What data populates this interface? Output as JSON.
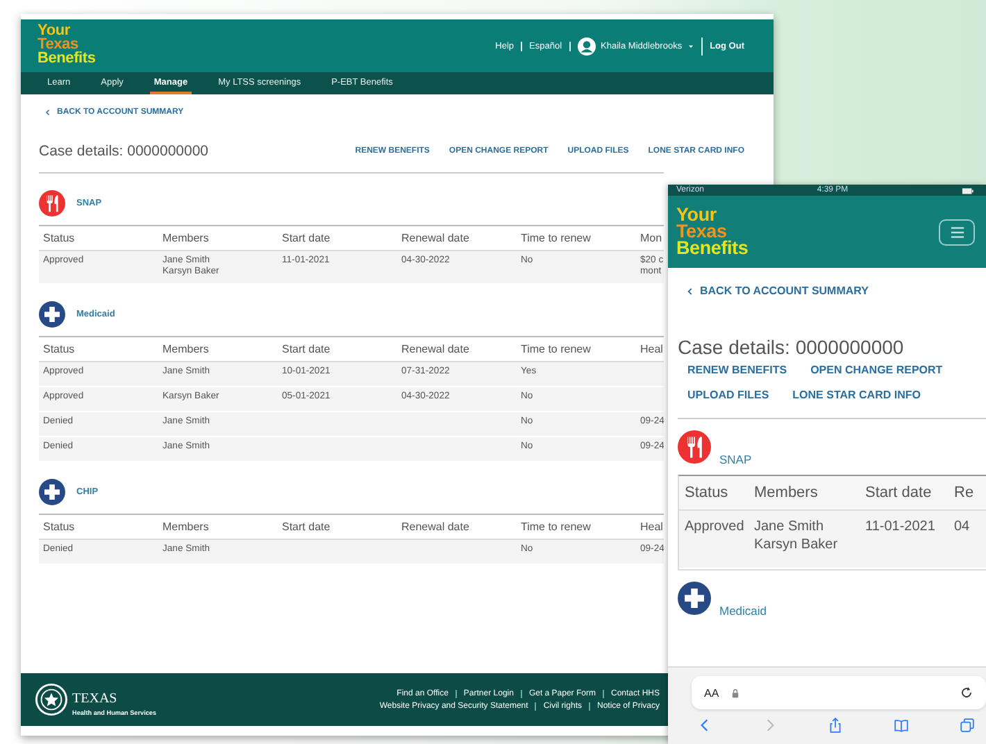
{
  "desktop": {
    "logo": [
      "Your",
      "Texas",
      "Benefits"
    ],
    "top_links": [
      "Help",
      "Español"
    ],
    "user_name": "Khaila Middlebrooks",
    "logout": "Log Out",
    "nav": [
      {
        "label": "Learn",
        "selected": false
      },
      {
        "label": "Apply",
        "selected": false
      },
      {
        "label": "Manage",
        "selected": true
      },
      {
        "label": "My LTSS screenings",
        "selected": false
      },
      {
        "label": "P-EBT Benefits",
        "selected": false
      }
    ],
    "back_link": "BACK TO ACCOUNT SUMMARY",
    "case_title": "Case details: 0000000000",
    "actions": [
      "RENEW BENEFITS",
      "OPEN CHANGE REPORT",
      "UPLOAD FILES",
      "LONE STAR CARD INFO"
    ],
    "programs": [
      {
        "name": "SNAP",
        "kind": "food",
        "columns": [
          "Status",
          "Members",
          "Start date",
          "Renewal date",
          "Time to renew",
          "Mon"
        ],
        "rows": [
          {
            "status": "Approved",
            "members": "Jane Smith\nKarsyn Baker",
            "start_date": "11-01-2021",
            "renewal_date": "04-30-2022",
            "time_to_renew": "No",
            "column_6": "$20 c\nmont"
          }
        ]
      },
      {
        "name": "Medicaid",
        "kind": "health",
        "columns": [
          "Status",
          "Members",
          "Start date",
          "Renewal date",
          "Time to renew",
          "Heal"
        ],
        "rows": [
          {
            "status": "Approved",
            "members": "Jane Smith",
            "start_date": "10-01-2021",
            "renewal_date": "07-31-2022",
            "time_to_renew": "Yes"
          },
          {
            "status": "Approved",
            "members": "Karsyn Baker",
            "start_date": "05-01-2021",
            "renewal_date": "04-30-2022",
            "time_to_renew": "No"
          },
          {
            "status": "Denied",
            "members": "Jane Smith",
            "time_to_renew": "No",
            "column_6": "09-24"
          },
          {
            "status": "Denied",
            "members": "Jane Smith",
            "time_to_renew": "No",
            "column_6": "09-24"
          }
        ]
      },
      {
        "name": "CHIP",
        "kind": "health",
        "columns": [
          "Status",
          "Members",
          "Start date",
          "Renewal date",
          "Time to renew",
          "Heal"
        ],
        "rows": [
          {
            "status": "Denied",
            "members": "Jane Smith",
            "time_to_renew": "No",
            "column_6": "09-24"
          }
        ]
      }
    ],
    "footer": {
      "seal_title": "TEXAS",
      "seal_subtitle": "Health and Human Services",
      "links": [
        [
          "Find an Office",
          "Partner Login",
          "Get a Paper Form",
          "Contact HHS"
        ],
        [
          "Website Privacy and Security Statement",
          "Civil rights",
          "Notice of Privacy"
        ]
      ]
    }
  },
  "phone": {
    "carrier": "Verizon",
    "time": "4:39 PM",
    "logo": [
      "Your",
      "Texas",
      "Benefits"
    ],
    "back_link": "BACK TO ACCOUNT SUMMARY",
    "case_title": "Case details: 0000000000",
    "actions": [
      [
        "RENEW BENEFITS",
        "OPEN CHANGE REPORT"
      ],
      [
        "UPLOAD FILES",
        "LONE STAR CARD INFO"
      ]
    ],
    "programs": [
      {
        "name": "SNAP",
        "kind": "food",
        "columns": [
          "Status",
          "Members",
          "Start date",
          "Re"
        ],
        "rows": [
          {
            "status": "Approved",
            "members": "Jane Smith\nKarsyn Baker",
            "start_date": "11-01-2021",
            "renewal_date": "04"
          }
        ]
      },
      {
        "name": "Medicaid",
        "kind": "health"
      }
    ],
    "browser": {
      "text_size_button": "AA"
    }
  }
}
